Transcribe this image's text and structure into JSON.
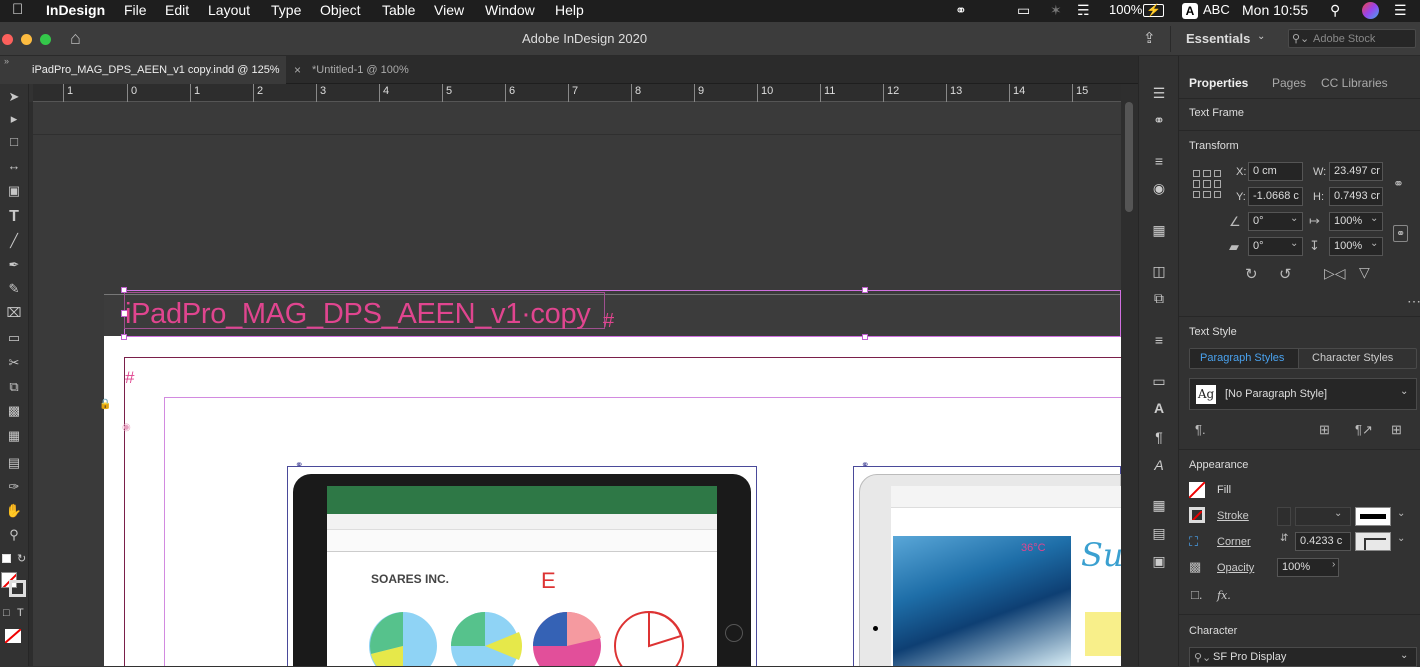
{
  "menubar": {
    "app_name": "InDesign",
    "items": [
      "File",
      "Edit",
      "Layout",
      "Type",
      "Object",
      "Table",
      "View",
      "Window",
      "Help"
    ],
    "battery": "100%",
    "input_source": "ABC",
    "clock": "Mon 10:55"
  },
  "app": {
    "title": "Adobe InDesign 2020",
    "workspace": "Essentials",
    "search_placeholder": "Adobe Stock"
  },
  "tabs": [
    {
      "label": "iPadPro_MAG_DPS_AEEN_v1 copy.indd @ 125%",
      "active": true
    },
    {
      "label": "*Untitled-1 @ 100%",
      "active": false
    }
  ],
  "ruler": {
    "ticks": [
      "1",
      "0",
      "1",
      "2",
      "3",
      "4",
      "5",
      "6",
      "7",
      "8",
      "9",
      "10",
      "11",
      "12",
      "13",
      "14",
      "15"
    ]
  },
  "document": {
    "frame_text": "iPadPro_MAG_DPS_AEEN_v1·copy",
    "hash_mark": "#",
    "tablet_left_heading": "SOARES INC.",
    "tablet_right_title": "Su",
    "tablet_right_badge": "36°C"
  },
  "properties_panel": {
    "tabs": [
      "Properties",
      "Pages",
      "CC Libraries"
    ],
    "selection_type": "Text Frame",
    "transform": {
      "title": "Transform",
      "x_label": "X:",
      "x_value": "0 cm",
      "y_label": "Y:",
      "y_value": "-1.0668 c",
      "w_label": "W:",
      "w_value": "23.497 cr",
      "h_label": "H:",
      "h_value": "0.7493 cr",
      "rotation": "0°",
      "shear": "0°",
      "scale_x": "100%",
      "scale_y": "100%"
    },
    "text_style": {
      "title": "Text Style",
      "tab_paragraph": "Paragraph Styles",
      "tab_character": "Character Styles",
      "style_icon_text": "Ag",
      "current_style": "[No Paragraph Style]"
    },
    "appearance": {
      "title": "Appearance",
      "fill_label": "Fill",
      "stroke_label": "Stroke",
      "corner_label": "Corner",
      "corner_value": "0.4233 c",
      "opacity_label": "Opacity",
      "opacity_value": "100%",
      "fx_label": "fx."
    },
    "character": {
      "title": "Character",
      "font": "SF Pro Display"
    }
  },
  "colors": {
    "menubar_bg": "#1e1e1e",
    "app_bg": "#323232",
    "frame_text": "#e0458f",
    "accent_blue": "#4aa2ee",
    "excel_green": "#2e7846"
  }
}
